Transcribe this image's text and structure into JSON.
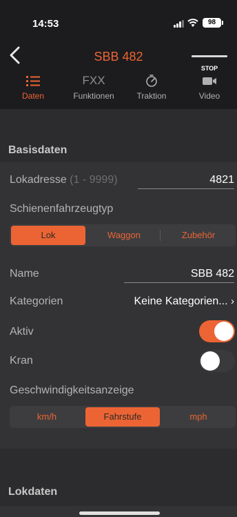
{
  "status_bar": {
    "time": "14:53",
    "battery": "98"
  },
  "nav": {
    "title": "SBB 482",
    "stop_label": "STOP"
  },
  "tabs": [
    {
      "label": "Daten",
      "icon": "list-icon",
      "active": true
    },
    {
      "label": "Funktionen",
      "icon": "fxx-icon",
      "icon_text": "FXX",
      "active": false
    },
    {
      "label": "Traktion",
      "icon": "speedometer-icon",
      "active": false
    },
    {
      "label": "Video",
      "icon": "video-camera-icon",
      "active": false
    }
  ],
  "basisdaten": {
    "section_title": "Basisdaten",
    "lokadresse_label": "Lokadresse",
    "lokadresse_hint": "(1 - 9999)",
    "lokadresse_value": "4821",
    "fahrzeugtyp_label": "Schienenfahrzeugtyp",
    "fahrzeugtyp_options": [
      "Lok",
      "Waggon",
      "Zubehör"
    ],
    "fahrzeugtyp_selected": "Lok",
    "name_label": "Name",
    "name_value": "SBB 482",
    "kategorien_label": "Kategorien",
    "kategorien_value": "Keine Kategorien...",
    "aktiv_label": "Aktiv",
    "aktiv_on": true,
    "kran_label": "Kran",
    "kran_on": false,
    "geschwindigkeit_label": "Geschwindigkeitsanzeige",
    "geschwindigkeit_options": [
      "km/h",
      "Fahrstufe",
      "mph"
    ],
    "geschwindigkeit_selected": "Fahrstufe"
  },
  "lokdaten": {
    "section_title": "Lokdaten"
  },
  "colors": {
    "accent": "#ec6434",
    "background": "#2c2c2e",
    "header": "#1c1c1e"
  }
}
